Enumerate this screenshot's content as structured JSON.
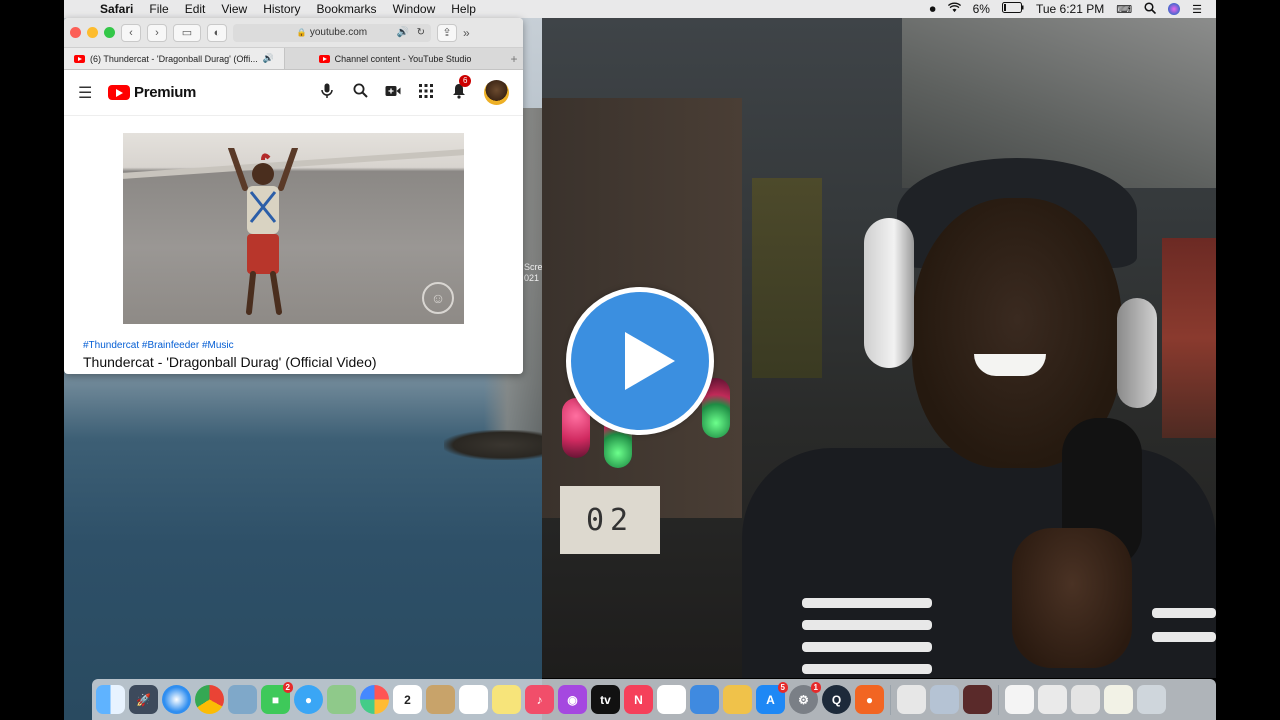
{
  "menubar": {
    "app_name": "Safari",
    "menus": [
      "File",
      "Edit",
      "View",
      "History",
      "Bookmarks",
      "Window",
      "Help"
    ],
    "battery": "6%",
    "clock": "Tue 6:21 PM"
  },
  "safari": {
    "address": "youtube.com",
    "tabs": [
      {
        "title": "(6) Thundercat - 'Dragonball Durag' (Offi..."
      },
      {
        "title": "Channel content - YouTube Studio"
      }
    ]
  },
  "youtube": {
    "brand": "Premium",
    "notification_count": "6",
    "hashtags": "#Thundercat #Brainfeeder #Music",
    "video_title": "Thundercat - 'Dragonball Durag' (Official Video)"
  },
  "desktop": {
    "file_label": "Scre 021"
  },
  "webcam": {
    "cube_digits": "02"
  },
  "dock": {
    "calendar_date": "2",
    "badges": {
      "facetime": "2",
      "appstore": "5",
      "settings": "1"
    }
  },
  "colors": {
    "play_button": "#3b8fe0",
    "youtube_red": "#ff0000",
    "link_blue": "#065fd4"
  }
}
